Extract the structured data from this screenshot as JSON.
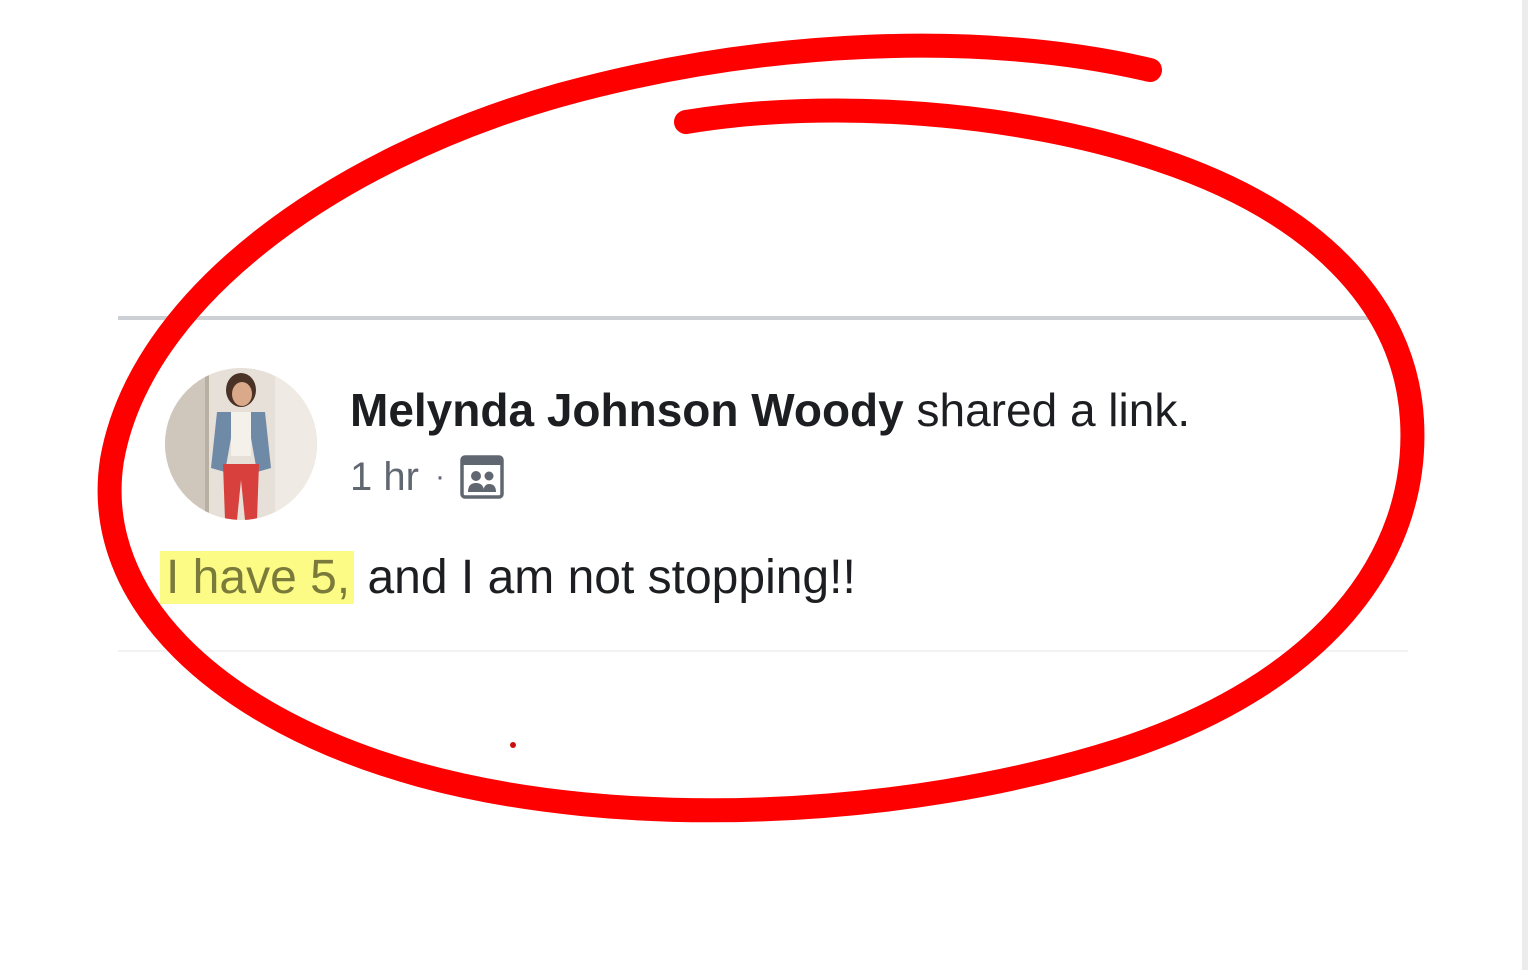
{
  "post": {
    "author": "Melynda Johnson Woody",
    "action": "shared a link.",
    "timestamp": "1 hr",
    "separator": "·",
    "audience_icon": "group-members-icon",
    "body_highlight": "I have 5,",
    "body_rest": "and I am not stopping!!"
  },
  "annotation": {
    "ellipse_color": "#ff0000",
    "highlight_color": "#fbfb86"
  }
}
